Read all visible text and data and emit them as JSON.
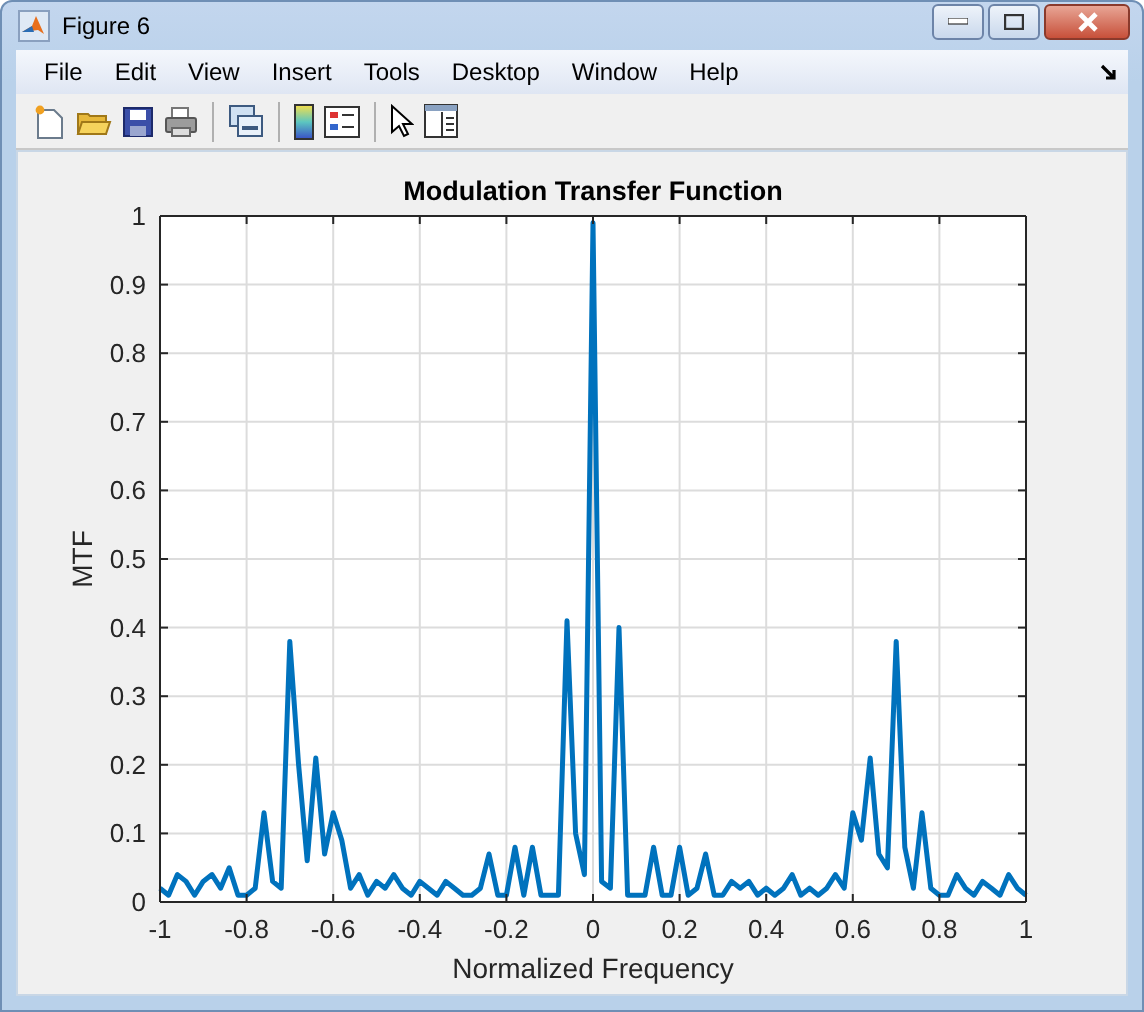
{
  "window": {
    "title": "Figure 6"
  },
  "menu": [
    "File",
    "Edit",
    "View",
    "Insert",
    "Tools",
    "Desktop",
    "Window",
    "Help"
  ],
  "figure": {
    "chart_data": {
      "type": "line",
      "title": "Modulation Transfer Function",
      "xlabel": "Normalized Frequency",
      "ylabel": "MTF",
      "xlim": [
        -1,
        1
      ],
      "ylim": [
        0,
        1
      ],
      "grid": true,
      "xticks": [
        {
          "value": -1,
          "label": "-1"
        },
        {
          "value": -0.8,
          "label": "-0.8"
        },
        {
          "value": -0.6,
          "label": "-0.6"
        },
        {
          "value": -0.4,
          "label": "-0.4"
        },
        {
          "value": -0.2,
          "label": "-0.2"
        },
        {
          "value": 0,
          "label": "0"
        },
        {
          "value": 0.2,
          "label": "0.2"
        },
        {
          "value": 0.4,
          "label": "0.4"
        },
        {
          "value": 0.6,
          "label": "0.6"
        },
        {
          "value": 0.8,
          "label": "0.8"
        },
        {
          "value": 1,
          "label": "1"
        }
      ],
      "yticks": [
        {
          "value": 0,
          "label": "0"
        },
        {
          "value": 0.1,
          "label": "0.1"
        },
        {
          "value": 0.2,
          "label": "0.2"
        },
        {
          "value": 0.3,
          "label": "0.3"
        },
        {
          "value": 0.4,
          "label": "0.4"
        },
        {
          "value": 0.5,
          "label": "0.5"
        },
        {
          "value": 0.6,
          "label": "0.6"
        },
        {
          "value": 0.7,
          "label": "0.7"
        },
        {
          "value": 0.8,
          "label": "0.8"
        },
        {
          "value": 0.9,
          "label": "0.9"
        },
        {
          "value": 1,
          "label": "1"
        }
      ],
      "x": [
        -1,
        -0.98,
        -0.96,
        -0.94,
        -0.92,
        -0.9,
        -0.88,
        -0.86,
        -0.84,
        -0.82,
        -0.8,
        -0.78,
        -0.76,
        -0.74,
        -0.72,
        -0.7,
        -0.68,
        -0.66,
        -0.64,
        -0.62,
        -0.6,
        -0.58,
        -0.56,
        -0.54,
        -0.52,
        -0.5,
        -0.48,
        -0.46,
        -0.44,
        -0.42,
        -0.4,
        -0.38,
        -0.36,
        -0.34,
        -0.32,
        -0.3,
        -0.28,
        -0.26,
        -0.24,
        -0.22,
        -0.2,
        -0.18,
        -0.16,
        -0.14,
        -0.12,
        -0.1,
        -0.08,
        -0.06,
        -0.04,
        -0.02,
        0,
        0.02,
        0.04,
        0.06,
        0.08,
        0.1,
        0.12,
        0.14,
        0.16,
        0.18,
        0.2,
        0.22,
        0.24,
        0.26,
        0.28,
        0.3,
        0.32,
        0.34,
        0.36,
        0.38,
        0.4,
        0.42,
        0.44,
        0.46,
        0.48,
        0.5,
        0.52,
        0.54,
        0.56,
        0.58,
        0.6,
        0.62,
        0.64,
        0.66,
        0.68,
        0.7,
        0.72,
        0.74,
        0.76,
        0.78,
        0.8,
        0.82,
        0.84,
        0.86,
        0.88,
        0.9,
        0.92,
        0.94,
        0.96,
        0.98,
        1
      ],
      "series": [
        {
          "color": "#0072bd",
          "values": [
            0.02,
            0.01,
            0.04,
            0.03,
            0.01,
            0.03,
            0.04,
            0.02,
            0.05,
            0.01,
            0.01,
            0.02,
            0.13,
            0.03,
            0.02,
            0.38,
            0.2,
            0.06,
            0.21,
            0.07,
            0.13,
            0.09,
            0.02,
            0.04,
            0.01,
            0.03,
            0.02,
            0.04,
            0.02,
            0.01,
            0.03,
            0.02,
            0.01,
            0.03,
            0.02,
            0.01,
            0.01,
            0.02,
            0.07,
            0.01,
            0.01,
            0.08,
            0.01,
            0.08,
            0.01,
            0.01,
            0.01,
            0.41,
            0.1,
            0.04,
            0.99,
            0.03,
            0.02,
            0.4,
            0.01,
            0.01,
            0.01,
            0.08,
            0.01,
            0.01,
            0.08,
            0.01,
            0.02,
            0.07,
            0.01,
            0.01,
            0.03,
            0.02,
            0.03,
            0.01,
            0.02,
            0.01,
            0.02,
            0.04,
            0.01,
            0.02,
            0.01,
            0.02,
            0.04,
            0.02,
            0.13,
            0.09,
            0.21,
            0.07,
            0.05,
            0.38,
            0.08,
            0.02,
            0.13,
            0.02,
            0.01,
            0.01,
            0.04,
            0.02,
            0.01,
            0.03,
            0.02,
            0.01,
            0.04,
            0.02,
            0.01
          ]
        }
      ]
    }
  }
}
